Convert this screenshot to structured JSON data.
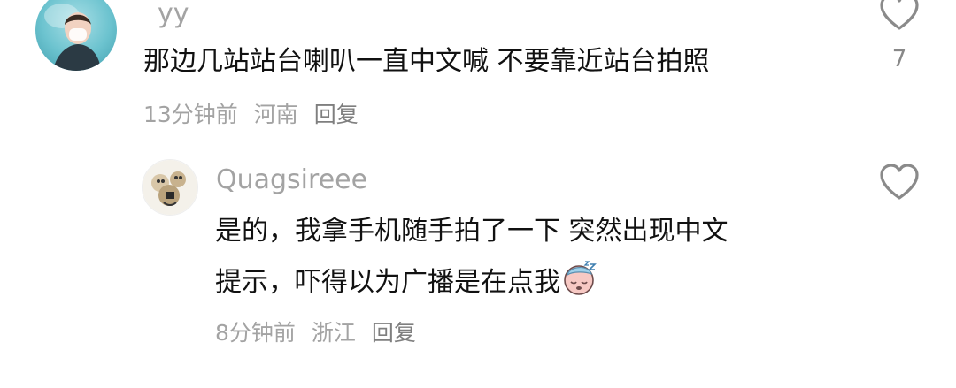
{
  "comments": [
    {
      "username": "yy",
      "text_lines": [
        "那边几站站台喇叭一直中文喊 不要靠近站台拍照"
      ],
      "time": "13分钟前",
      "location": "河南",
      "reply_label": "回复",
      "likes": "7",
      "avatar_icon": "avatar-photo"
    },
    {
      "username": "Quagsireee",
      "text_lines": [
        "是的，我拿手机随手拍了一下 突然出现中文",
        "提示，吓得以为广播是在点我"
      ],
      "time": "8分钟前",
      "location": "浙江",
      "reply_label": "回复",
      "likes": "",
      "emoji": "sleepy-face-emoji",
      "avatar_icon": "avatar-photo"
    }
  ],
  "colors": {
    "secondary_text": "#a3a3a3",
    "primary_text": "#111111",
    "heart_outline": "#8a8a8a"
  },
  "icons": {
    "like": "heart-outline-icon"
  }
}
